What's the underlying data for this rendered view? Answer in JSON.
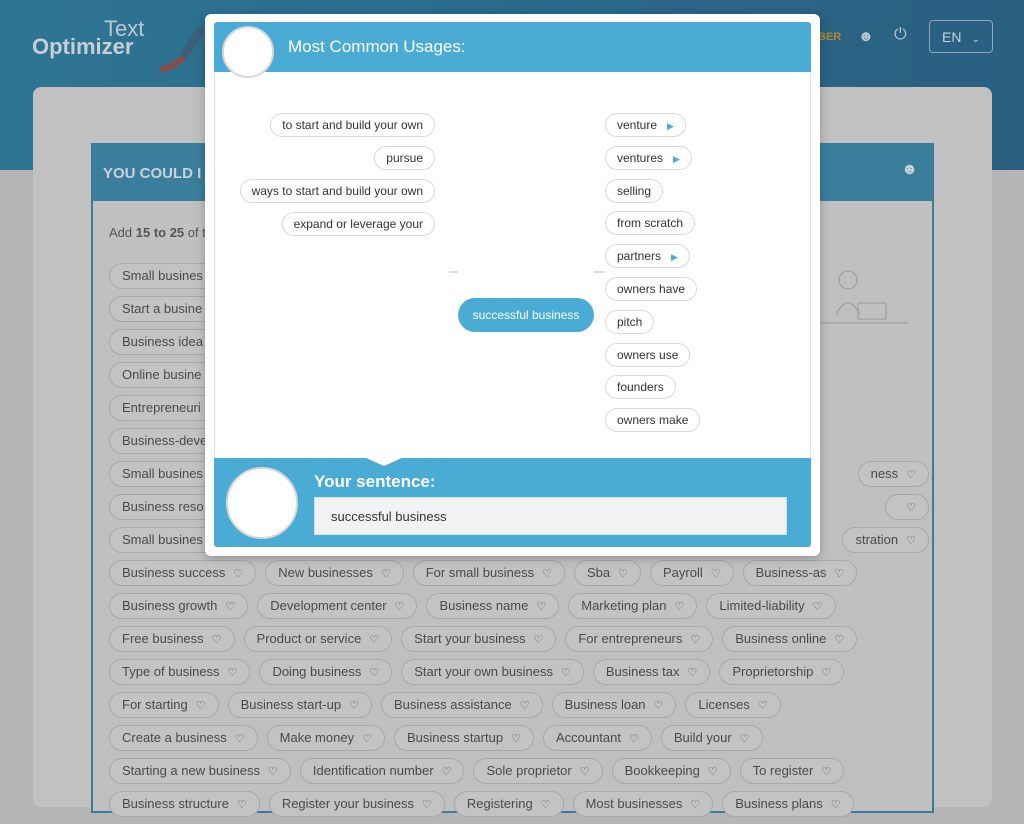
{
  "header": {
    "logo_top": "Text",
    "logo_bottom": "Optimizer",
    "member_partial": "BER",
    "lang": "EN"
  },
  "panel": {
    "title_partial": "YOU COULD I",
    "hint_prefix": "Add ",
    "hint_bold": "15 to 25",
    "hint_suffix": " of t"
  },
  "tag_rows": [
    [
      "Small busines"
    ],
    [
      "Start a busine"
    ],
    [
      "Business idea"
    ],
    [
      "Online busine"
    ],
    [
      "Entrepreneuri"
    ],
    [
      "Business-deve"
    ],
    [
      "Small busines",
      "ness"
    ],
    [
      "Business reso",
      ""
    ],
    [
      "Small busines",
      "stration"
    ],
    [
      "Business success",
      "New businesses",
      "For small business",
      "Sba",
      "Payroll",
      "Business-as"
    ],
    [
      "Business growth",
      "Development center",
      "Business name",
      "Marketing plan",
      "Limited-liability"
    ],
    [
      "Free business",
      "Product or service",
      "Start your business",
      "For entrepreneurs",
      "Business online"
    ],
    [
      "Type of business",
      "Doing business",
      "Start your own business",
      "Business tax",
      "Proprietorship"
    ],
    [
      "For starting",
      "Business start-up",
      "Business assistance",
      "Business loan",
      "Licenses"
    ],
    [
      "Create a business",
      "Make money",
      "Business startup",
      "Accountant",
      "Build your"
    ],
    [
      "Starting a new business",
      "Identification number",
      "Sole proprietor",
      "Bookkeeping",
      "To register"
    ],
    [
      "Business structure",
      "Register your business",
      "Registering",
      "Most businesses",
      "Business plans"
    ]
  ],
  "modal": {
    "title": "Most Common Usages:",
    "left_nodes": [
      "to start and build your own",
      "pursue",
      "ways to start and build your own",
      "expand or leverage your"
    ],
    "center": "successful business",
    "right_nodes": [
      {
        "label": "venture",
        "expandable": true
      },
      {
        "label": "ventures",
        "expandable": true
      },
      {
        "label": "selling",
        "expandable": false
      },
      {
        "label": "from scratch",
        "expandable": false
      },
      {
        "label": "partners",
        "expandable": true
      },
      {
        "label": "owners have",
        "expandable": false
      },
      {
        "label": "pitch",
        "expandable": false
      },
      {
        "label": "owners use",
        "expandable": false
      },
      {
        "label": "founders",
        "expandable": false
      },
      {
        "label": "owners make",
        "expandable": false
      }
    ],
    "sentence_label": "Your sentence:",
    "sentence_value": "successful business"
  },
  "colors": {
    "accent": "#4aabd5",
    "header_dim": "#2e7594"
  }
}
